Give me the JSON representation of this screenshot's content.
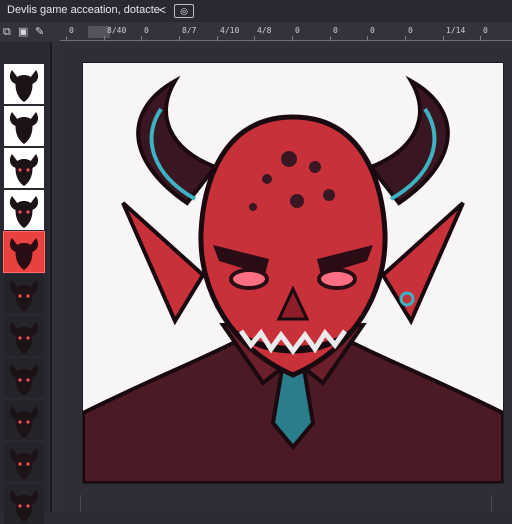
{
  "window": {
    "title": "Devlis game acceation, dotacte",
    "chevron": "<",
    "button_glyph": "◎"
  },
  "toolbar": {
    "tools": [
      {
        "icon": "layers-icon",
        "glyph": "⧉"
      },
      {
        "icon": "image-icon",
        "glyph": "▣"
      },
      {
        "icon": "brush-icon",
        "glyph": "✎"
      }
    ]
  },
  "ruler": {
    "labels": [
      "0",
      "8/40",
      "0",
      "8/7",
      "4/10",
      "4/8",
      "0",
      "0",
      "0",
      "0",
      "1/14",
      "0"
    ]
  },
  "layers": {
    "count": 11,
    "selected_index": 4
  },
  "artwork": {
    "subject": "red devil with horns",
    "colors": {
      "skin": "#c8303a",
      "skin_dark": "#8e1d2a",
      "horn": "#3a1622",
      "horn_light": "#6a2a3a",
      "horn_rim": "#3bb3c3",
      "eyes": "#ff6f84",
      "teeth": "#eaeaea",
      "body": "#4b1a24",
      "accent_teal": "#2a7d8a"
    }
  }
}
